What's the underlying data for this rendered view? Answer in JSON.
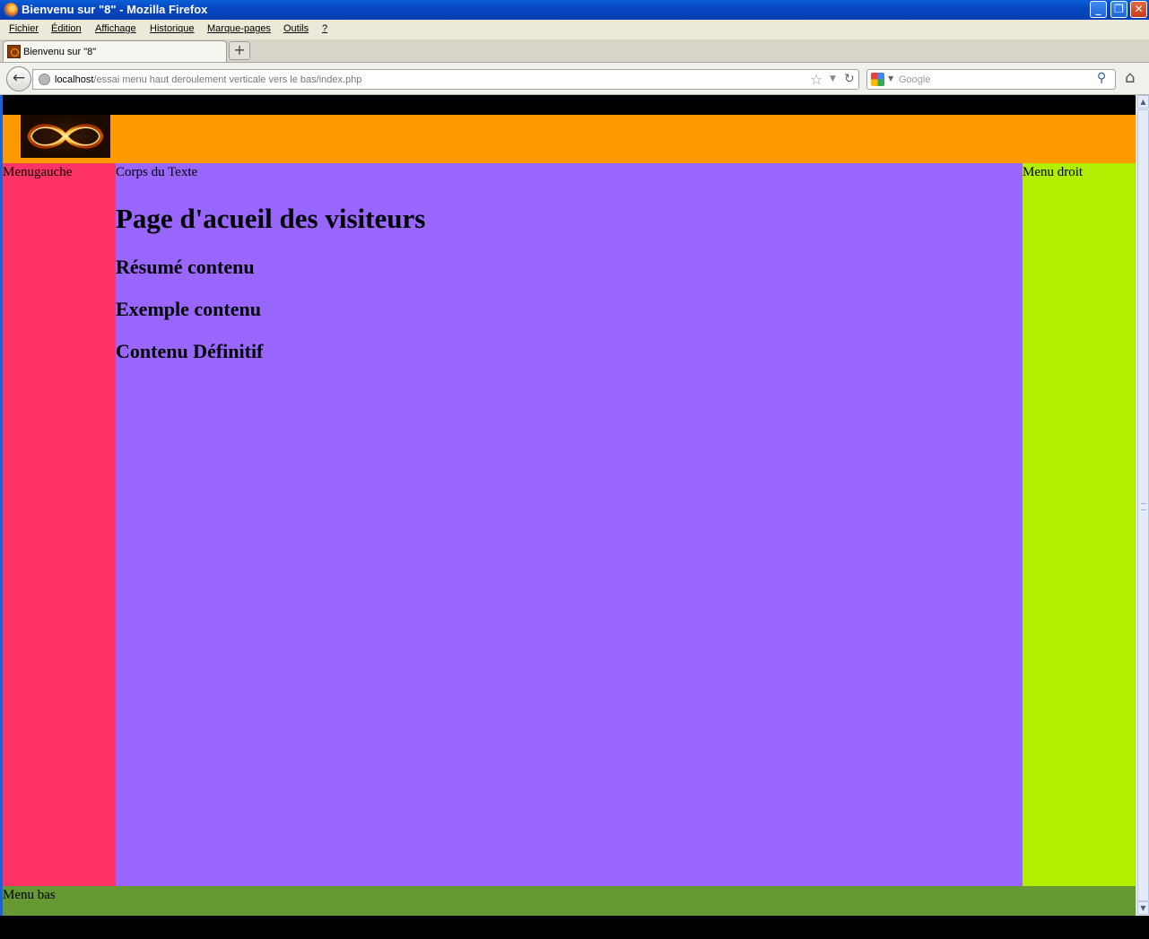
{
  "window": {
    "title": "Bienvenu sur \"8\" - Mozilla Firefox",
    "controls": {
      "minimize": "_",
      "maximize": "❐",
      "close": "✕"
    }
  },
  "menubar": {
    "items": [
      "Fichier",
      "Édition",
      "Affichage",
      "Historique",
      "Marque-pages",
      "Outils",
      "?"
    ]
  },
  "tabs": [
    {
      "label": "Bienvenu sur \"8\"",
      "active": true
    }
  ],
  "newtab_label": "+",
  "navbar": {
    "back_icon": "←",
    "url_host": "localhost",
    "url_path": "/essai menu haut deroulement verticale vers le bas/index.php",
    "search_placeholder": "Google",
    "star_icon": "☆",
    "dropdown_icon": "▼",
    "reload_icon": "↻",
    "search_drop_icon": "▼",
    "search_go_icon": "⚲",
    "home_icon": "⌂"
  },
  "page": {
    "left_menu": "Menugauche",
    "content_label": "Corps du Texte",
    "heading": "Page d'acueil des visiteurs",
    "subheadings": [
      "Résumé contenu",
      "Exemple contenu",
      "Contenu Définitif"
    ],
    "right_menu": "Menu droit",
    "footer": "Menu bas"
  },
  "scrollbar": {
    "up": "▲",
    "down": "▼"
  },
  "colors": {
    "header": "#ff9900",
    "left_menu": "#ff3366",
    "content": "#9966ff",
    "right_menu": "#b2ee00",
    "footer": "#669933"
  }
}
